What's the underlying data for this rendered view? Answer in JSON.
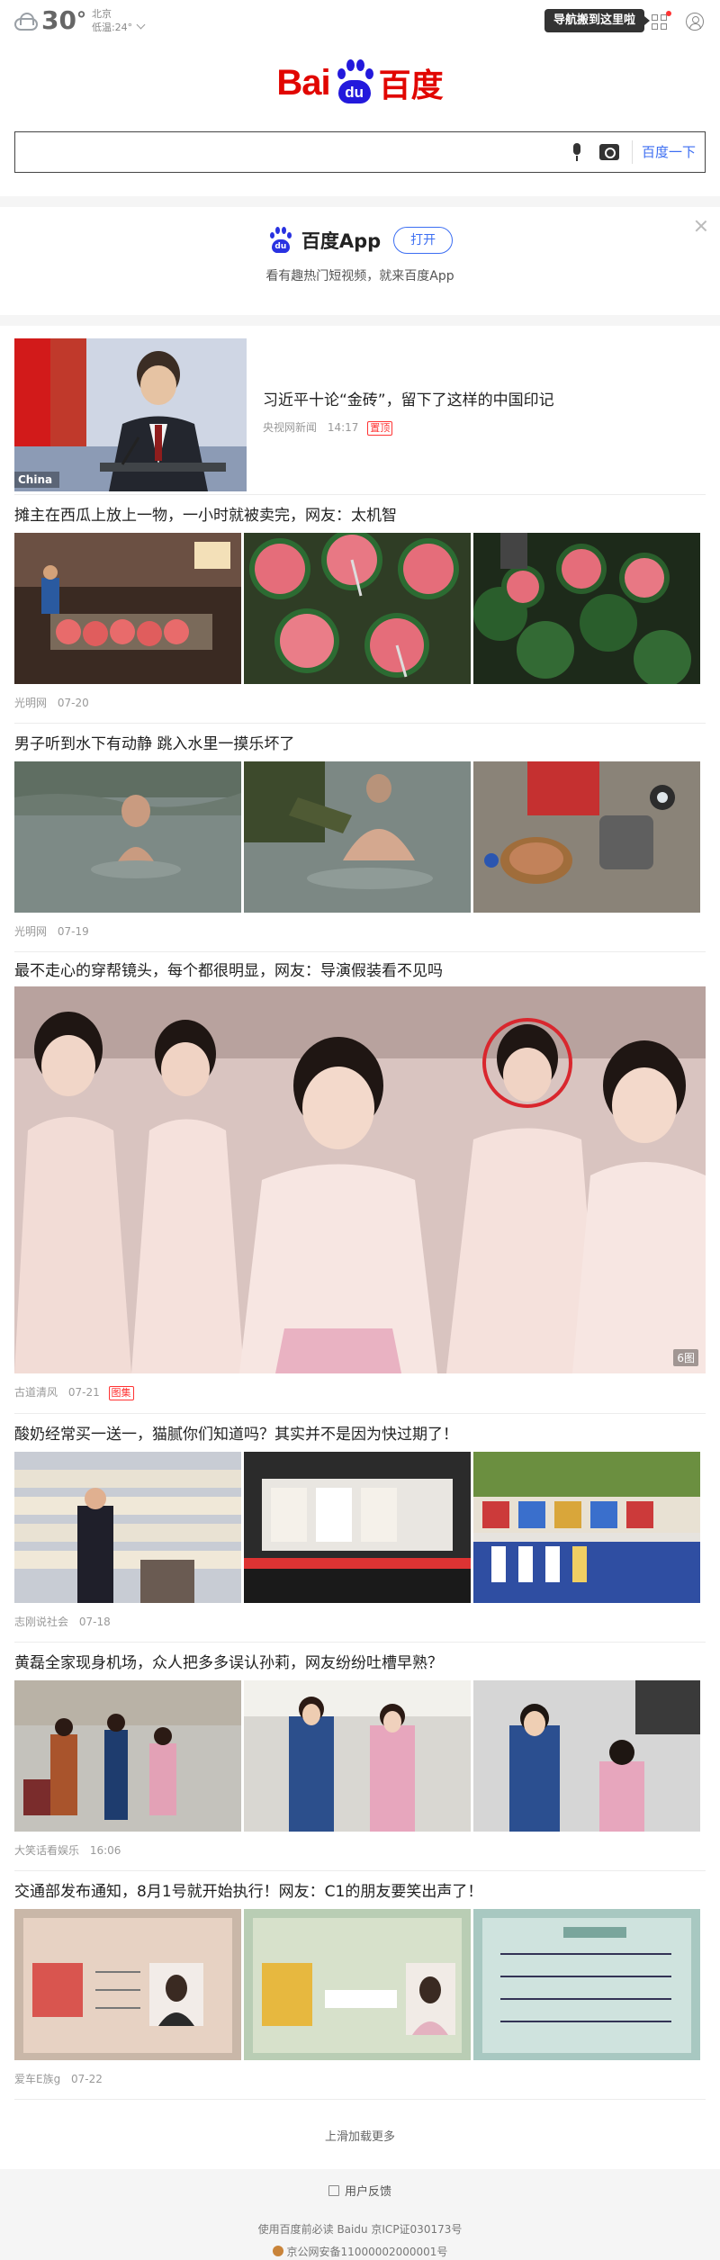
{
  "weather": {
    "temp": "30",
    "deg_symbol": "°",
    "city": "北京",
    "low": "低温:24°"
  },
  "header": {
    "nav_tip": "导航搬到这里啦"
  },
  "logo": {
    "bai": "Bai",
    "du": "du",
    "cn": "百度"
  },
  "search": {
    "value": "",
    "button": "百度一下"
  },
  "app_banner": {
    "name": "百度App",
    "open": "打开",
    "subtitle": "看有趣热门短视频，就来百度App"
  },
  "feed": [
    {
      "title": "习近平十论“金砖”，留下了这样的中国印记",
      "source": "央视网新闻",
      "time": "14:17",
      "tag": "置顶",
      "image_caption": "China"
    },
    {
      "title": "摊主在西瓜上放上一物，一小时就被卖完，网友：太机智",
      "source": "光明网",
      "time": "07-20"
    },
    {
      "title": "男子听到水下有动静 跳入水里一摸乐坏了",
      "source": "光明网",
      "time": "07-19"
    },
    {
      "title": "最不走心的穿帮镜头，每个都很明显，网友：导演假装看不见吗",
      "source": "古道清风",
      "time": "07-21",
      "tag": "图集",
      "count": "6图"
    },
    {
      "title": "酸奶经常买一送一，猫腻你们知道吗？其实并不是因为快过期了！",
      "source": "志刚说社会",
      "time": "07-18"
    },
    {
      "title": "黄磊全家现身机场，众人把多多误认孙莉，网友纷纷吐槽早熟？",
      "source": "大笑话看娱乐",
      "time": "16:06"
    },
    {
      "title": "交通部发布通知，8月1号就开始执行！网友：C1的朋友要笑出声了！",
      "source": "爱车E族g",
      "time": "07-22"
    }
  ],
  "load_more": "上滑加载更多",
  "footer": {
    "feedback": "用户反馈",
    "line1": "使用百度前必读 Baidu 京ICP证030173号",
    "line2": "京公网安备11000002000001号"
  },
  "colors": {
    "brand_red": "#e10601",
    "brand_blue": "#2319dc",
    "link_blue": "#3c6ef2",
    "tag_red": "#ff3333"
  }
}
